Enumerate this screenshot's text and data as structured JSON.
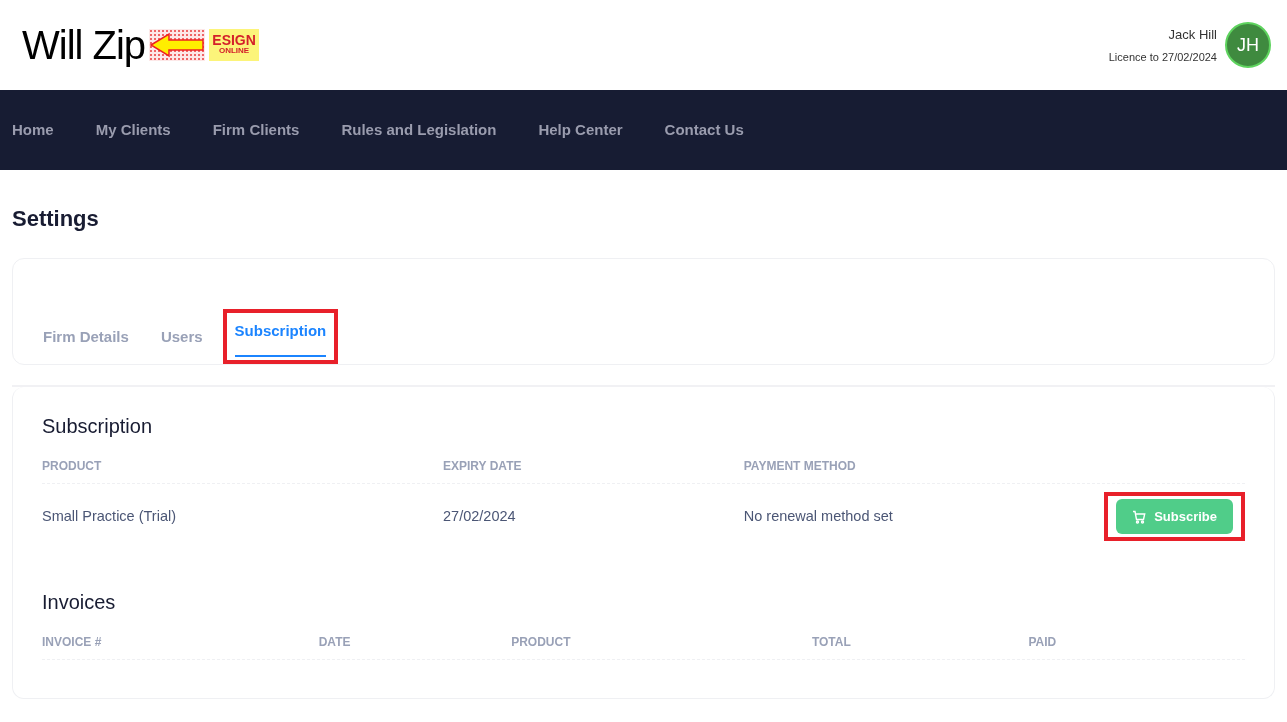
{
  "header": {
    "logo": {
      "text": "Will Zip",
      "badge_top": "ESIGN",
      "badge_bottom": "ONLINE"
    },
    "user": {
      "name": "Jack Hill",
      "licence": "Licence to 27/02/2024",
      "initials": "JH"
    }
  },
  "nav": [
    {
      "label": "Home"
    },
    {
      "label": "My Clients"
    },
    {
      "label": "Firm Clients"
    },
    {
      "label": "Rules and Legislation"
    },
    {
      "label": "Help Center"
    },
    {
      "label": "Contact Us"
    }
  ],
  "page_title": "Settings",
  "tabs": [
    {
      "label": "Firm Details",
      "selected": false,
      "highlighted": false
    },
    {
      "label": "Users",
      "selected": false,
      "highlighted": false
    },
    {
      "label": "Subscription",
      "selected": true,
      "highlighted": true
    }
  ],
  "subscription": {
    "title": "Subscription",
    "columns": [
      "PRODUCT",
      "EXPIRY DATE",
      "PAYMENT METHOD"
    ],
    "rows": [
      [
        "Small Practice (Trial)",
        "27/02/2024",
        "No renewal method set"
      ]
    ],
    "button": {
      "label": "Subscribe",
      "highlighted": true
    }
  },
  "invoices": {
    "title": "Invoices",
    "columns": [
      "INVOICE #",
      "DATE",
      "PRODUCT",
      "TOTAL",
      "PAID"
    ]
  }
}
